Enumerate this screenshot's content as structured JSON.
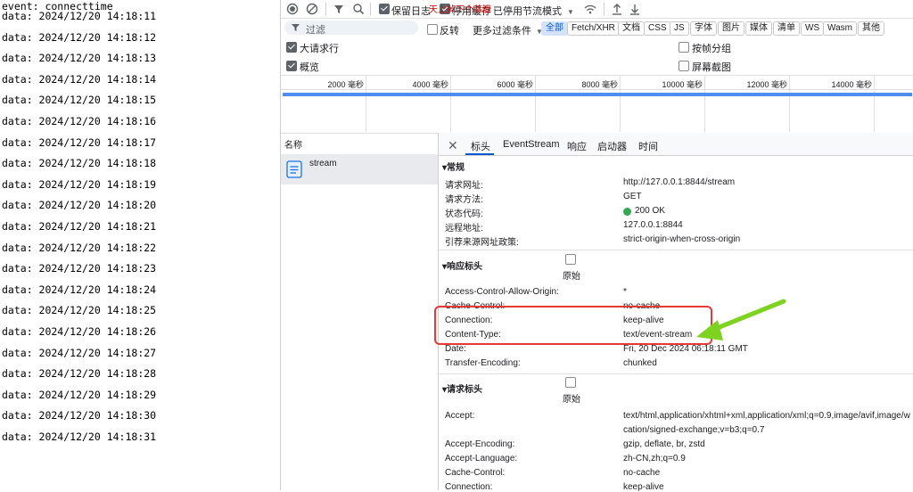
{
  "console": {
    "lines": [
      "event: connecttime",
      "data: 2024/12/20 14:18:11",
      "data: 2024/12/20 14:18:12",
      "data: 2024/12/20 14:18:13",
      "data: 2024/12/20 14:18:14",
      "data: 2024/12/20 14:18:15",
      "data: 2024/12/20 14:18:16",
      "data: 2024/12/20 14:18:17",
      "data: 2024/12/20 14:18:18",
      "data: 2024/12/20 14:18:19",
      "data: 2024/12/20 14:18:20",
      "data: 2024/12/20 14:18:21",
      "data: 2024/12/20 14:18:22",
      "data: 2024/12/20 14:18:23",
      "data: 2024/12/20 14:18:24",
      "data: 2024/12/20 14:18:25",
      "data: 2024/12/20 14:18:26",
      "data: 2024/12/20 14:18:27",
      "data: 2024/12/20 14:18:28",
      "data: 2024/12/20 14:18:29",
      "data: 2024/12/20 14:18:30",
      "data: 2024/12/20 14:18:31"
    ]
  },
  "toolbar": {
    "preserve_log": "保留日志",
    "disable_cache": "停用缓存",
    "throttle": "已停用节流模式",
    "watermark": "天上掉下个蒜瓣"
  },
  "filter": {
    "placeholder": "过滤",
    "invert": "反转",
    "more_filters": "更多过滤条件",
    "chips": [
      "全部",
      "Fetch/XHR",
      "文档",
      "CSS",
      "JS",
      "字体",
      "图片",
      "媒体",
      "清单",
      "WS",
      "Wasm",
      "其他"
    ],
    "active_chip": "全部"
  },
  "options": {
    "big_rows": "大请求行",
    "overview": "概览",
    "group_by_frame": "按帧分组",
    "screenshots": "屏幕截图"
  },
  "timeline": {
    "ticks": [
      "2000 毫秒",
      "4000 毫秒",
      "6000 毫秒",
      "8000 毫秒",
      "10000 毫秒",
      "12000 毫秒",
      "14000 毫秒"
    ]
  },
  "requests": {
    "column_name": "名称",
    "items": [
      {
        "name": "stream"
      }
    ]
  },
  "detail_tabs": [
    "标头",
    "EventStream",
    "响应",
    "启动器",
    "时间"
  ],
  "active_tab": "标头",
  "general": {
    "title": "常规",
    "rows": [
      {
        "key": "请求网址:",
        "value": "http://127.0.0.1:8844/stream"
      },
      {
        "key": "请求方法:",
        "value": "GET"
      },
      {
        "key": "状态代码:",
        "value": "200 OK"
      },
      {
        "key": "远程地址:",
        "value": "127.0.0.1:8844"
      },
      {
        "key": "引荐来源网址政策:",
        "value": "strict-origin-when-cross-origin"
      }
    ]
  },
  "response_headers": {
    "title": "响应标头",
    "raw_label": "原始",
    "rows": [
      {
        "key": "Access-Control-Allow-Origin:",
        "value": "*"
      },
      {
        "key": "Cache-Control:",
        "value": "no-cache"
      },
      {
        "key": "Connection:",
        "value": "keep-alive"
      },
      {
        "key": "Content-Type:",
        "value": "text/event-stream"
      },
      {
        "key": "Date:",
        "value": "Fri, 20 Dec 2024 06:18:11 GMT"
      },
      {
        "key": "Transfer-Encoding:",
        "value": "chunked"
      }
    ]
  },
  "request_headers": {
    "title": "请求标头",
    "raw_label": "原始",
    "rows": [
      {
        "key": "Accept:",
        "value": "text/html,application/xhtml+xml,application/xml;q=0.9,image/avif,image/w"
      },
      {
        "key": "",
        "value": "cation/signed-exchange;v=b3;q=0.7"
      },
      {
        "key": "Accept-Encoding:",
        "value": "gzip, deflate, br, zstd"
      },
      {
        "key": "Accept-Language:",
        "value": "zh-CN,zh;q=0.9"
      },
      {
        "key": "Cache-Control:",
        "value": "no-cache"
      },
      {
        "key": "Connection:",
        "value": "keep-alive"
      }
    ]
  },
  "colors": {
    "accent": "#0b57d0",
    "status_ok": "#34a853",
    "highlight_box": "#e53935",
    "arrow": "#7ed321"
  }
}
